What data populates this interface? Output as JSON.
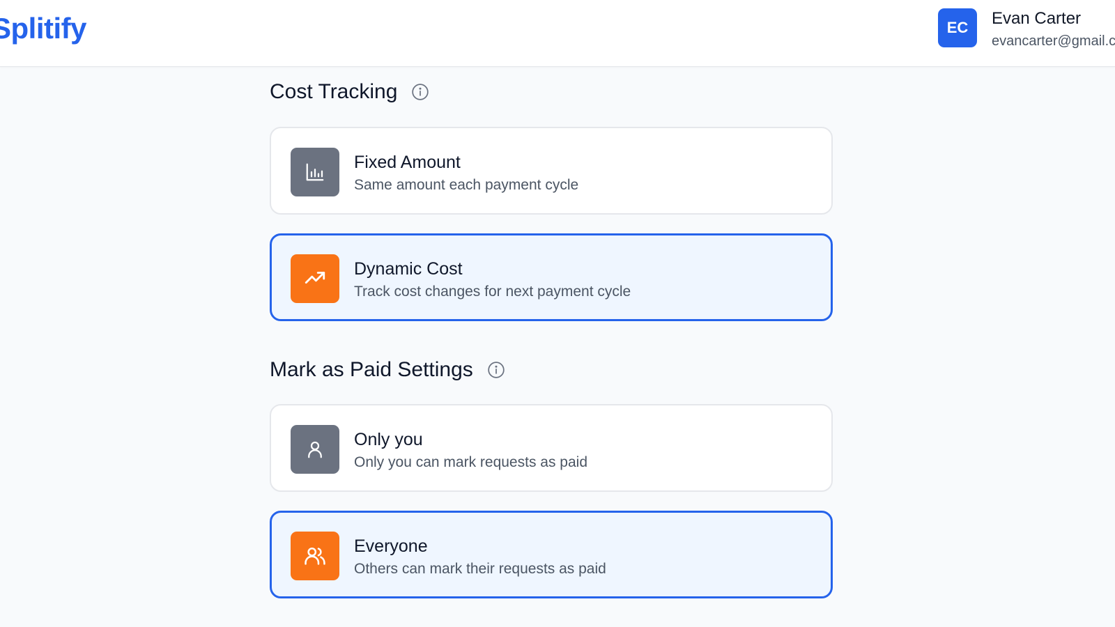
{
  "header": {
    "logo": "Splitify",
    "user": {
      "initials": "EC",
      "name": "Evan Carter",
      "email": "evancarter@gmail.com"
    }
  },
  "cost_tracking": {
    "title": "Cost Tracking",
    "options": [
      {
        "title": "Fixed Amount",
        "description": "Same amount each payment cycle",
        "icon": "bar-chart-icon",
        "selected": false
      },
      {
        "title": "Dynamic Cost",
        "description": "Track cost changes for next payment cycle",
        "icon": "trending-up-icon",
        "selected": true
      }
    ]
  },
  "mark_as_paid": {
    "title": "Mark as Paid Settings",
    "options": [
      {
        "title": "Only you",
        "description": "Only you can mark requests as paid",
        "icon": "user-icon",
        "selected": false
      },
      {
        "title": "Everyone",
        "description": "Others can mark their requests as paid",
        "icon": "users-icon",
        "selected": true
      }
    ]
  },
  "colors": {
    "accent": "#2563eb",
    "selected_icon_bg": "#f97316",
    "unselected_icon_bg": "#6b7280",
    "selected_card_bg": "#eff6ff"
  }
}
